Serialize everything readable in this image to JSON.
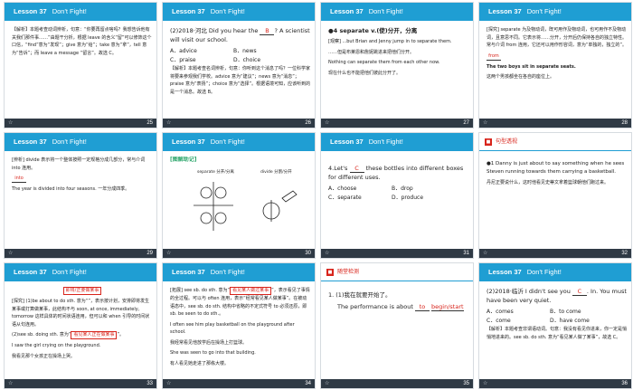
{
  "slides": [
    {
      "lesson": "Lesson 37",
      "title": "Don't Fight!",
      "number": "25",
      "lines": [
        "【解析】本题考查动词辨析，句意：“你要再留点啥吗？我想告诉他有关我们那件事……”由题干分析，根据 leave 的含义“留”可以修饰这个口信，“find”意为“发现”；give 意为“给”；take 意为“拿”，tell 意为“告诉”；而 leave a message “留言”。故选 C。"
      ]
    },
    {
      "lesson": "Lesson 37",
      "title": "Don't Fight!",
      "number": "26",
      "q": "(2)2018·河北  Did you hear the",
      "q_blank": "B",
      "q_tail": "? A scientist will visit our school.",
      "options": [
        "A．advice",
        "B．news",
        "C．praise",
        "D．choice"
      ],
      "note": "【解析】本题考查名词辨析，句意：你听到这个消息了吗？一位科学家将要来参观我们学校。advice 意为“建议”；news 意为“消息”；praise 意为“表扬”；choice 意为“选择”。根据语境可知，应该听到的是一个消息。故选 B。"
    },
    {
      "lesson": "Lesson 37",
      "title": "Don't Fight!",
      "number": "27",
      "word": "●4  separate v.(使)分开，分离",
      "lines": [
        "[观察] ...but Brian and Jenny jump in to separate them.",
        "……但是布莱恩和詹妮跳进来把他们分开。",
        "Nothing can separate them from each other now.",
        "现在什么也不能把他们彼此分开了。"
      ]
    },
    {
      "lesson": "Lesson 37",
      "title": "Don't Fight!",
      "number": "28",
      "lines": [
        "[探究] separate 为及物动词，既可用作及物动词，也可用作不及物动词，且意思不同。它表示将……分开，分开后仍保持各自的独立特性。常与介词 from 连用，它还可以用作形容词，意为“单独的，独立的”。",
        "The two boys sit in separate seats.",
        "这两个男孩都坐在各自的座位上。"
      ],
      "from_word": "from"
    },
    {
      "lesson": "Lesson 37",
      "title": "Don't Fight!",
      "number": "29",
      "lines": [
        "[辨析] divide 表示将一个整体按照一定规格分成几部分，常与介词 into 连用。",
        "The year is divided into four seasons. 一年分成四季。"
      ],
      "into_word": "into"
    },
    {
      "lesson": "Lesson 37",
      "title": "Don't Fight!",
      "number": "30",
      "memo": "[图解助记]",
      "sep_label": "separate 分开/分离",
      "div_label": "divide 分割/分开"
    },
    {
      "lesson": "Lesson 37",
      "title": "Don't Fight!",
      "number": "31",
      "q1": "4.Let's",
      "q_blank": "C",
      "q2": "these bottles into different boxes for different uses.",
      "options": [
        "A．choose",
        "B．drop",
        "C．separate",
        "D．produce"
      ]
    },
    {
      "section": "句型透视",
      "number": "32",
      "lines": [
        "●1  Danny is just about to say something when he sees Steven running towards them carrying a basketball.",
        "丹尼正要说什么，这时他看见史蒂文拿着篮球朝他们跑过来。"
      ]
    },
    {
      "lesson": "Lesson 37",
      "title": "Don't Fight!",
      "number": "33",
      "label_top": "即将/正要做某事",
      "lines": [
        "[探究] (1)be about to do sth. 意为“",
        "”，表示按计划，安排即将发生某事或打算做某事，此结构不与 soon, at once, immediately, tomorrow 这样具体的时间状语连用，但可以和 when 引导的时间状语从句连用。",
        "(2)see sb. doing sth. 意为“",
        "”。",
        "I saw the girl crying on the playground.",
        "我看见那个女孩正在操场上哭。"
      ],
      "label_mid": "看见某人正在做某事"
    },
    {
      "lesson": "Lesson 37",
      "title": "Don't Fight!",
      "number": "34",
      "label_top": "看见某人做过某事",
      "lines": [
        "[拓展] see sb. do sth. 意为“",
        "”，表示看见了事情的全过程。可以与 often 连用，表示“经常看见某人做某事”。在被动语态中，see sb. do sth. 结构中省略的不定式符号 to 必须还原，即 sb. be seen to do sth.。",
        "I often see him play basketball on the playground after school.",
        "我经常看见他放学后在操场上打篮球。",
        "She was seen to go into that building.",
        "有人看见她走进了那栋大楼。"
      ]
    },
    {
      "section": "随堂检测",
      "number": "35",
      "q": "1. (1)我在就要开始了。",
      "q2": "The performance is about",
      "b1": "to",
      "b2": "begin/start"
    },
    {
      "lesson": "Lesson 37",
      "title": "Don't Fight!",
      "number": "36",
      "q": "(2)2018·临沂  I didn't see you",
      "q_blank": "C",
      "q_tail": ". In. You must have been very quiet.",
      "options": [
        "A．comes",
        "B．to come",
        "C．come",
        "D．have come"
      ],
      "note": "【解析】本题考查非谓语动词。句意：我没有看见你进来，你一定是悄悄地进来的。see sb. do sth. 意为“看见某人做了某事”，故选 C。"
    }
  ],
  "colors": {
    "header": "#1f9ed3",
    "footer": "#2f3a45",
    "accent": "#d8241b",
    "tag": "#e8501f"
  },
  "icons": {
    "footer": "star-icon",
    "section": "square-marker-icon"
  }
}
